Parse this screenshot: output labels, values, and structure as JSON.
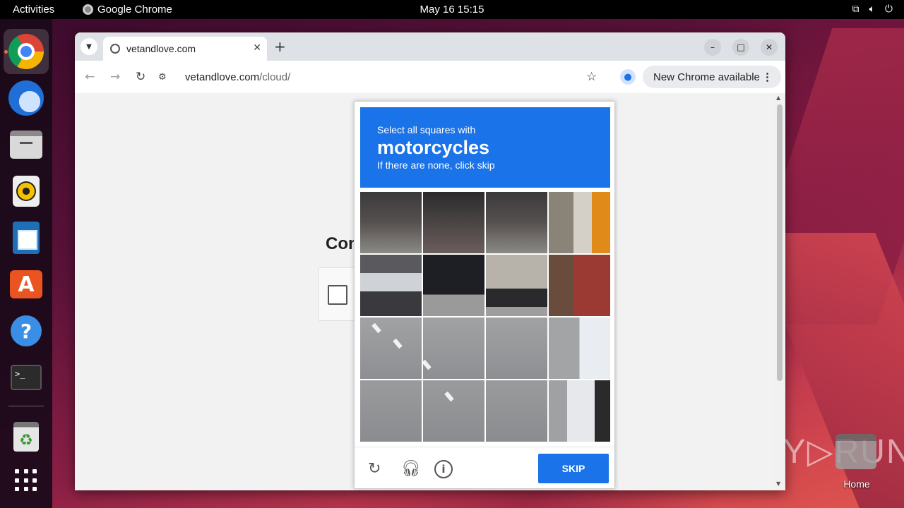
{
  "topbar": {
    "activities": "Activities",
    "app_name": "Google Chrome",
    "clock": "May 16  15:15"
  },
  "dock": {
    "items": [
      {
        "name": "Google Chrome",
        "icon": "chrome-icon"
      },
      {
        "name": "Thunderbird",
        "icon": "thunderbird-icon"
      },
      {
        "name": "Files",
        "icon": "files-icon"
      },
      {
        "name": "Rhythmbox",
        "icon": "rhythmbox-icon"
      },
      {
        "name": "LibreOffice Writer",
        "icon": "writer-icon"
      },
      {
        "name": "Ubuntu Software",
        "icon": "software-store-icon"
      },
      {
        "name": "Help",
        "icon": "help-icon"
      },
      {
        "name": "Terminal",
        "icon": "terminal-icon"
      },
      {
        "name": "Trash",
        "icon": "trash-icon"
      },
      {
        "name": "Show Applications",
        "icon": "app-grid-icon"
      }
    ],
    "help_glyph": "?",
    "terminal_glyph": ">_",
    "store_glyph": "A",
    "trash_glyph": "♻"
  },
  "browser": {
    "tab_title": "vetandlove.com",
    "url_host": "vetandlove.com",
    "url_path": "/cloud/",
    "update_label": "New Chrome available"
  },
  "page": {
    "heading_partial": "Con"
  },
  "captcha": {
    "instruction": "Select all squares with",
    "target": "motorcycles",
    "hint": "If there are none, click skip",
    "skip_label": "SKIP",
    "info_glyph": "i",
    "accent_color": "#1a73e8"
  },
  "desktop": {
    "home_label": "Home",
    "watermark": "ANY▷RUN"
  }
}
